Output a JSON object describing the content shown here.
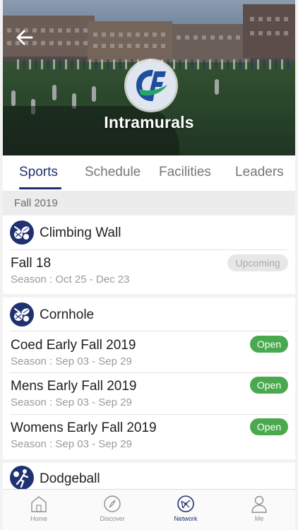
{
  "app": {
    "title": "Intramurals",
    "back_icon": "back-arrow-icon",
    "logo_icon": "school-logo-icon",
    "colors": {
      "primary": "#1f3170",
      "open": "#4aa94f",
      "upcoming_bg": "#e7e7e7"
    }
  },
  "tabs": [
    {
      "label": "Sports",
      "active": true
    },
    {
      "label": "Schedule",
      "active": false
    },
    {
      "label": "Facilities",
      "active": false
    },
    {
      "label": "Leaders",
      "active": false
    }
  ],
  "season": "Fall 2019",
  "sports": [
    {
      "name": "Climbing Wall",
      "icon": "multi-sport-icon",
      "leagues": [
        {
          "name": "Fall 18",
          "dates": "Season : Oct 25 - Dec 23",
          "status": "Upcoming"
        }
      ]
    },
    {
      "name": "Cornhole",
      "icon": "multi-sport-icon",
      "leagues": [
        {
          "name": "Coed Early Fall 2019",
          "dates": "Season : Sep 03 - Sep 29",
          "status": "Open"
        },
        {
          "name": "Mens Early Fall 2019",
          "dates": "Season : Sep 03 - Sep 29",
          "status": "Open"
        },
        {
          "name": "Womens Early Fall 2019",
          "dates": "Season : Sep 03 - Sep 29",
          "status": "Open"
        }
      ]
    },
    {
      "name": "Dodgeball",
      "icon": "dodgeball-player-icon",
      "leagues": []
    }
  ],
  "bottom_nav": [
    {
      "label": "Home",
      "icon": "home-icon",
      "active": false
    },
    {
      "label": "Discover",
      "icon": "compass-icon",
      "active": false
    },
    {
      "label": "Network",
      "icon": "network-icon",
      "active": true
    },
    {
      "label": "Me",
      "icon": "person-icon",
      "active": false
    }
  ]
}
